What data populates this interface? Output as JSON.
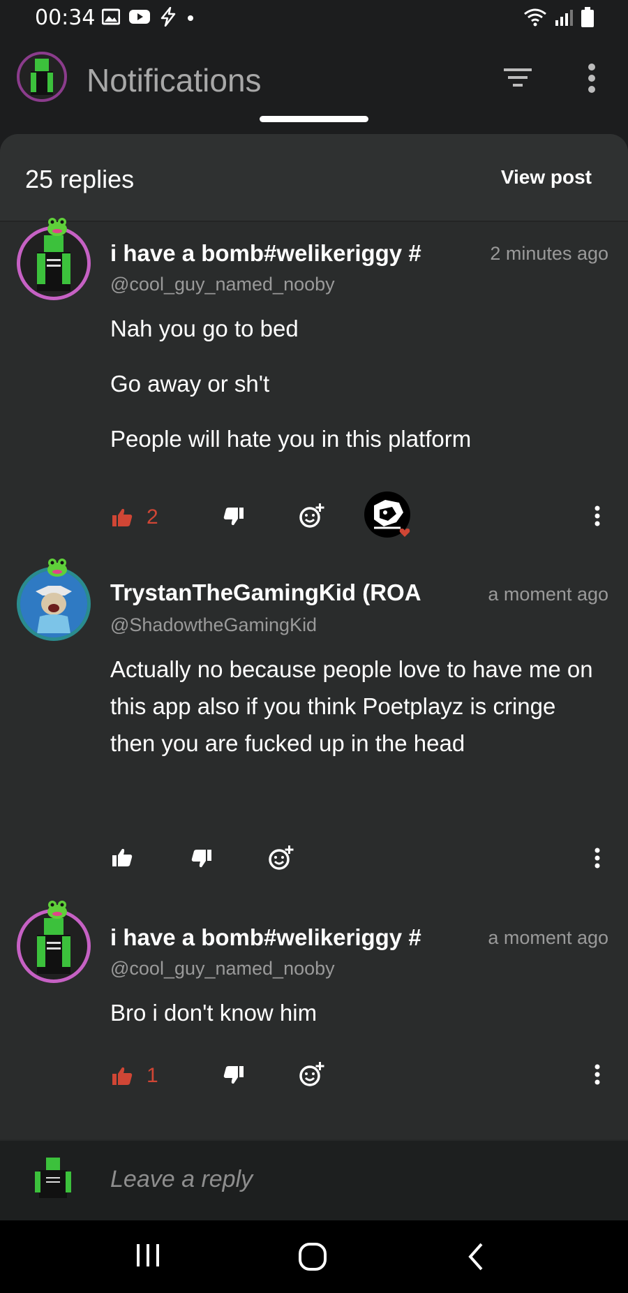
{
  "status_bar": {
    "time": "00:34",
    "left_icons": [
      "image-icon",
      "youtube-icon",
      "flash-icon",
      "dot-icon"
    ],
    "right_icons": [
      "wifi-icon",
      "signal-icon",
      "battery-icon"
    ]
  },
  "appbar": {
    "title": "Notifications",
    "icons": [
      "filter-icon",
      "more-vertical-icon"
    ]
  },
  "sheet": {
    "replies_label": "25 replies",
    "view_post_label": "View post"
  },
  "comments": [
    {
      "name": "i have a bomb#welikeriggy #",
      "time": "2 minutes ago",
      "handle": "@cool_guy_named_nooby",
      "lines": [
        "Nah you go to bed",
        "Go away or sh't",
        "People will hate you in this platform"
      ],
      "likes": "2",
      "liked": true,
      "has_reaction_avatar": true
    },
    {
      "name": "TrystanTheGamingKid (ROA",
      "time": "a moment ago",
      "handle": "@ShadowtheGamingKid",
      "lines": [
        "Actually no because people love to have me on this app also if you think Poetplayz is cringe then you are fucked up in the head"
      ],
      "likes": "",
      "liked": false,
      "has_reaction_avatar": false
    },
    {
      "name": "i have a bomb#welikeriggy #",
      "time": "a moment ago",
      "handle": "@cool_guy_named_nooby",
      "lines": [
        "Bro i don't know him"
      ],
      "likes": "1",
      "liked": true,
      "has_reaction_avatar": false
    }
  ],
  "reply_bar": {
    "placeholder": "Leave a reply"
  },
  "colors": {
    "like_active": "#d04635",
    "accent_ring": "#c661c4",
    "background": "#2a2c2c"
  }
}
